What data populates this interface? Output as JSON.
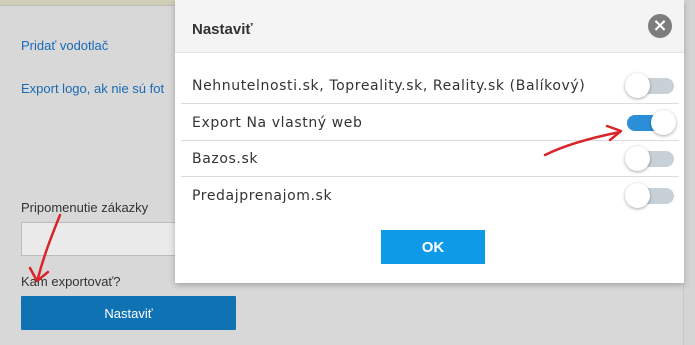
{
  "background": {
    "top_right_mark": "☐☐",
    "add_watermark_link": "Pridať vodotlač",
    "export_logo_link": "Export logo, ak nie sú fot",
    "reminder_label": "Pripomenutie zákazky",
    "where_export_label": "Kam exportovať?",
    "set_button_label": "Nastaviť"
  },
  "modal": {
    "title": "Nastaviť",
    "close_icon": "×",
    "options": [
      {
        "label": "Nehnutelnosti.sk, Topreality.sk, Reality.sk (Balíkový)",
        "enabled": false
      },
      {
        "label": "Export Na vlastný web",
        "enabled": true
      },
      {
        "label": "Bazos.sk",
        "enabled": false
      },
      {
        "label": "Predajprenajom.sk",
        "enabled": false
      }
    ],
    "ok_label": "OK"
  },
  "colors": {
    "accent": "#0e9ae6",
    "toggle_on": "#2a8fd6",
    "toggle_off": "#c8d0d8",
    "annotation": "#d9252a"
  }
}
